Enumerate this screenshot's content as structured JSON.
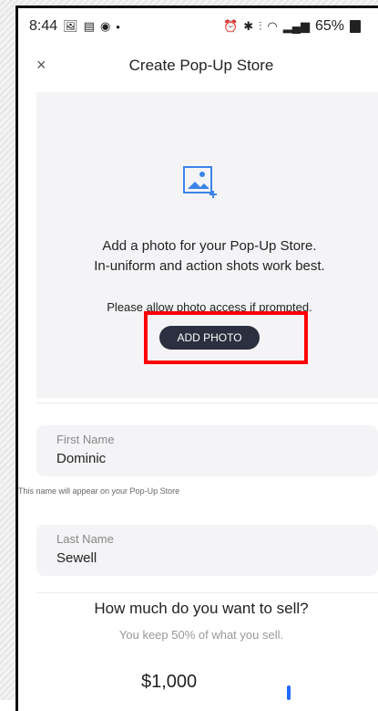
{
  "status_bar": {
    "time": "8:44",
    "left_icons": [
      "image-icon",
      "news-icon",
      "podcast-icon",
      "dot-icon"
    ],
    "right_icons": [
      "alarm-icon",
      "bluetooth-icon",
      "vibrate-icon",
      "wifi-icon",
      "signal-icon"
    ],
    "battery": "65%"
  },
  "header": {
    "close_label": "×",
    "title": "Create Pop-Up Store"
  },
  "photo_section": {
    "line1": "Add a photo for your Pop-Up Store.",
    "line2": "In-uniform and action shots work best.",
    "line3": "Please allow photo access if prompted.",
    "button_label": "ADD PHOTO"
  },
  "form": {
    "first_name": {
      "label": "First Name",
      "value": "Dominic"
    },
    "first_name_helper": "This name will appear on your Pop-Up Store",
    "last_name": {
      "label": "Last Name",
      "value": "Sewell"
    }
  },
  "sell": {
    "title": "How much do you want to sell?",
    "subtitle": "You keep 50% of what you sell.",
    "amount": "$1,000"
  },
  "colors": {
    "button_bg": "#2b2f3f",
    "highlight": "#ff0000",
    "panel_bg": "#f4f4f7",
    "slider": "#1e6bff"
  }
}
